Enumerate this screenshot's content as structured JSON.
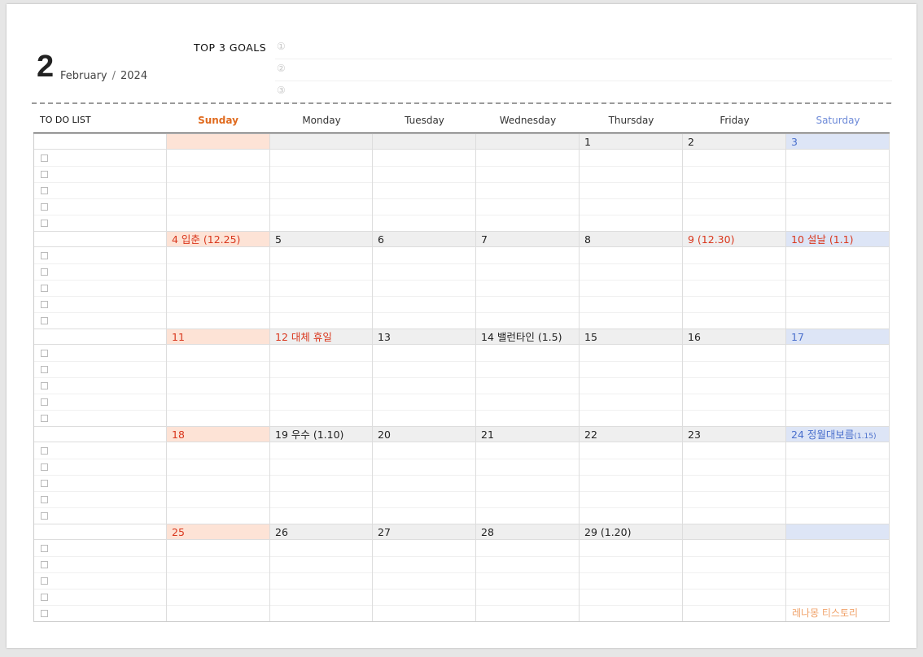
{
  "header": {
    "month_number": "2",
    "month_name": "February",
    "separator": "/",
    "year": "2024",
    "goals_title": "TOP 3 GOALS",
    "goal_markers": [
      "①",
      "②",
      "③"
    ]
  },
  "columns": {
    "todo": "TO DO LIST",
    "days": [
      "Sunday",
      "Monday",
      "Tuesday",
      "Wednesday",
      "Thursday",
      "Friday",
      "Saturday"
    ]
  },
  "weeks": [
    [
      "",
      "",
      "",
      "",
      "1",
      "2",
      "3"
    ],
    [
      "4  입춘  (12.25)",
      "5",
      "6",
      "7",
      "8",
      "9  (12.30)",
      "10  설날  (1.1)"
    ],
    [
      "11",
      "12  대체  휴일",
      "13",
      "14  밸런타인  (1.5)",
      "15",
      "16",
      "17"
    ],
    [
      "18",
      "19  우수  (1.10)",
      "20",
      "21",
      "22",
      "23",
      "24  정월대보름"
    ],
    [
      "25",
      "26",
      "27",
      "28",
      "29  (1.20)",
      "",
      ""
    ]
  ],
  "week4_saturday_note": "(1.15)",
  "brand": "레나몽  티스토리",
  "colors": {
    "sunday": "#e06b1f",
    "saturday": "#6d8ad8",
    "holiday_red": "#d9371d",
    "sunday_bg": "#fde3d6",
    "saturday_bg": "#dde5f6",
    "weekday_bg": "#efefef"
  }
}
